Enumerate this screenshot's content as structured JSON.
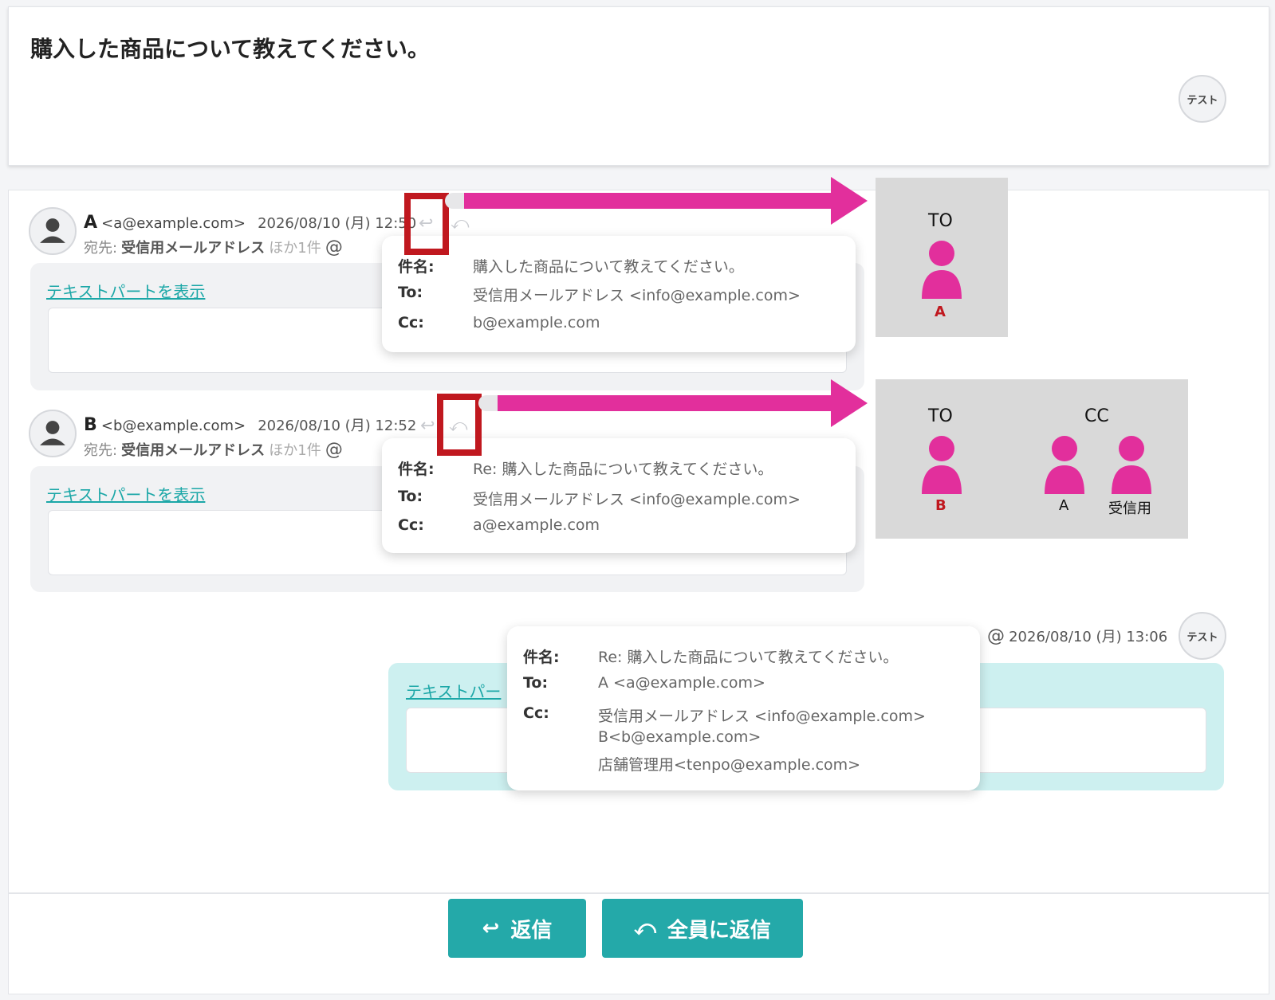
{
  "thread": {
    "title": "購入した商品について教えてください。",
    "owner_avatar": "テスト"
  },
  "messages": [
    {
      "sender": "A",
      "email": "<a@example.com>",
      "datetime": "2026/08/10 (月) 12:50",
      "to_label": "宛先:",
      "to_value": "受信用メールアドレス",
      "to_more": "ほか1件",
      "text_part": "テキストパートを表示",
      "popup": {
        "subject_label": "件名:",
        "subject": "購入した商品について教えてください。",
        "to_label": "To:",
        "to": "受信用メールアドレス <info@example.com>",
        "cc_label": "Cc:",
        "cc": "b@example.com"
      }
    },
    {
      "sender": "B",
      "email": "<b@example.com>",
      "datetime": "2026/08/10 (月) 12:52",
      "to_label": "宛先:",
      "to_value": "受信用メールアドレス",
      "to_more": "ほか1件",
      "text_part": "テキストパートを表示",
      "popup": {
        "subject_label": "件名:",
        "subject": "Re: 購入した商品について教えてください。",
        "to_label": "To:",
        "to": "受信用メールアドレス <info@example.com>",
        "cc_label": "Cc:",
        "cc": "a@example.com"
      }
    },
    {
      "datetime": "2026/08/10 (月) 13:06",
      "avatar": "テスト",
      "text_part": "テキストパー",
      "popup": {
        "subject_label": "件名:",
        "subject": "Re: 購入した商品について教えてください。",
        "to_label": "To:",
        "to": "A <a@example.com>",
        "cc_label": "Cc:",
        "cc_lines": [
          "受信用メールアドレス <info@example.com>",
          "B<b@example.com>",
          "店舗管理用<tenpo@example.com>"
        ]
      }
    }
  ],
  "diagram1": {
    "to_heading": "TO",
    "to_person": "A"
  },
  "diagram2": {
    "to_heading": "TO",
    "cc_heading": "CC",
    "to_person": "B",
    "cc_persons": [
      "A",
      "受信用"
    ]
  },
  "actions": {
    "reply": "返信",
    "reply_all": "全員に返信"
  },
  "colors": {
    "accent": "#24a9a9",
    "highlight": "#c0181f",
    "arrow": "#e22f9c",
    "person": "#e22f9c"
  }
}
